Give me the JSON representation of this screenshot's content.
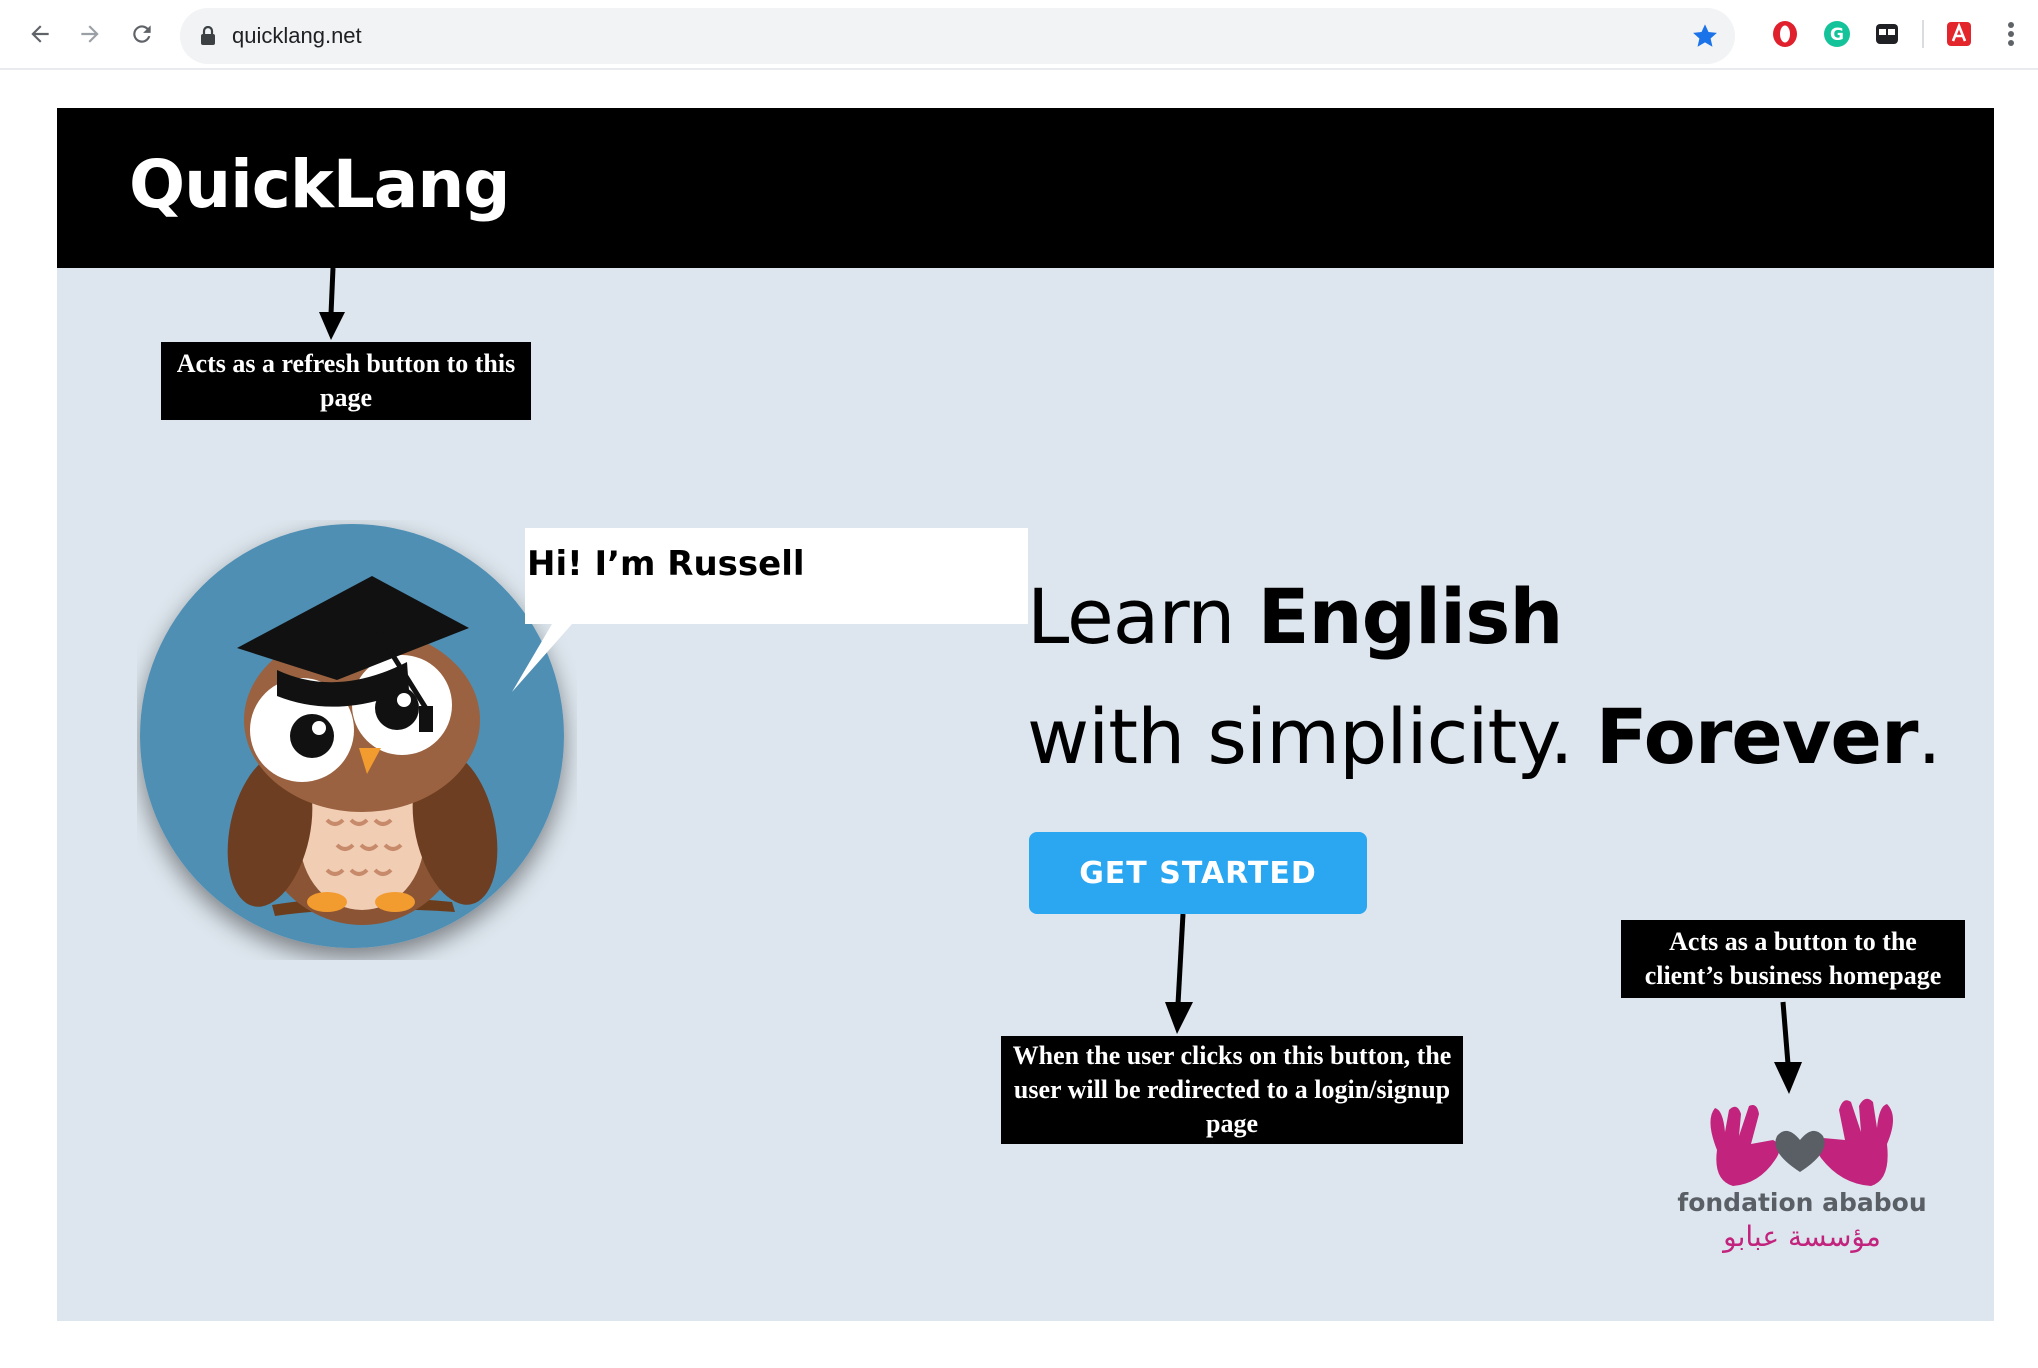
{
  "browser": {
    "url": "quicklang.net",
    "icons": [
      "back-arrow-icon",
      "forward-arrow-icon",
      "reload-icon",
      "lock-icon",
      "bookmark-star-icon",
      "opera-extension-icon",
      "grammarly-extension-icon",
      "extension-icon",
      "acrobat-extension-icon",
      "more-menu-icon"
    ]
  },
  "site": {
    "logo": "QuickLang",
    "bubble": "Hi! I’m Russell",
    "headline_line1_normal": "Learn ",
    "headline_line1_bold": "English",
    "headline_line2_normal": "with simplicity. ",
    "headline_line2_bold": "Forever",
    "headline_line2_end": ".",
    "cta_label": "GET STARTED",
    "client_logo_name": "fondation ababou",
    "client_logo_arabic": "مؤسسة عبابو"
  },
  "annotations": {
    "logo_note": "Acts as a refresh button to this page",
    "cta_note": "When the user clicks on this button, the user will be redirected to a login/signup page",
    "client_note": "Acts as a button to the client’s business homepage"
  },
  "colors": {
    "page_bg": "#dde6ee",
    "header_bg": "#000000",
    "cta_bg": "#2ba6f0",
    "brand_pink": "#c2237d"
  }
}
